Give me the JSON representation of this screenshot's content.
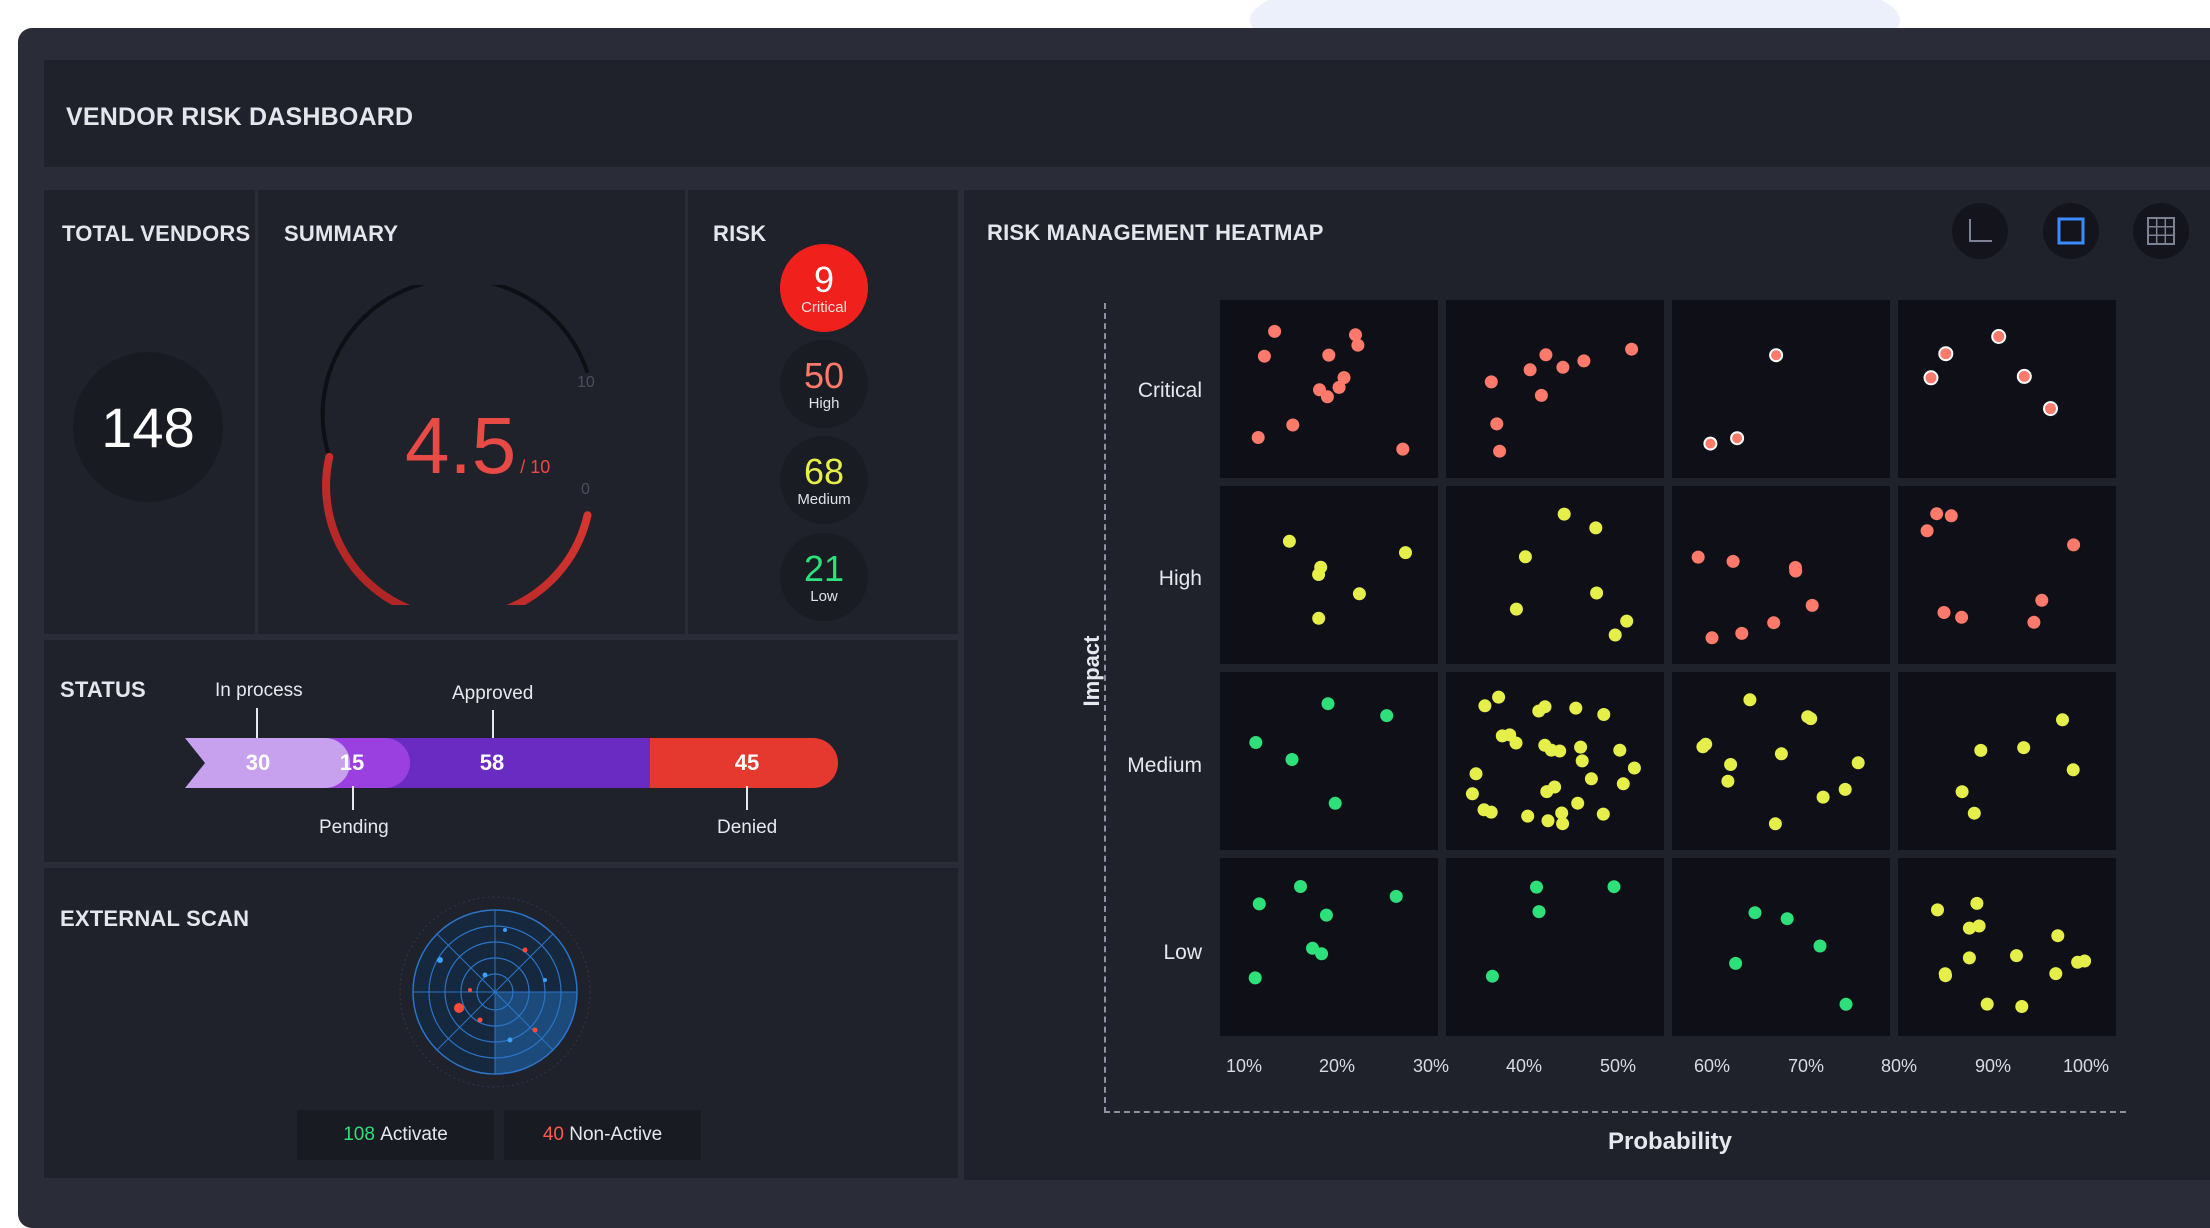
{
  "header": {
    "title": "VENDOR RISK DASHBOARD"
  },
  "total_vendors": {
    "title": "TOTAL VENDORS",
    "value": "148"
  },
  "summary": {
    "title": "SUMMARY",
    "score": "4.5",
    "score_suffix": "/ 10",
    "scale_max": "10",
    "scale_min": "0",
    "score_value": 4.5,
    "score_max": 10
  },
  "risk": {
    "title": "RISK",
    "items": [
      {
        "value": "9",
        "label": "Critical",
        "color": "#ff3b30"
      },
      {
        "value": "50",
        "label": "High",
        "color": "#ff7a6b"
      },
      {
        "value": "68",
        "label": "Medium",
        "color": "#e6ef4a"
      },
      {
        "value": "21",
        "label": "Low",
        "color": "#2ee07a"
      }
    ]
  },
  "status": {
    "title": "STATUS",
    "segments": [
      {
        "value": "30",
        "label": "In process",
        "color": "#c7a0ee"
      },
      {
        "value": "15",
        "label": "Pending",
        "color": "#9a3fe0"
      },
      {
        "value": "58",
        "label": "Approved",
        "color": "#6a2bc2"
      },
      {
        "value": "45",
        "label": "Denied",
        "color": "#e5392f"
      }
    ]
  },
  "external_scan": {
    "title": "EXTERNAL SCAN",
    "active_count": "108",
    "active_label": "Activate",
    "inactive_count": "40",
    "inactive_label": "Non-Active",
    "active_color": "#2ee07a",
    "inactive_color": "#ff5a4a"
  },
  "heatmap": {
    "title": "RISK MANAGEMENT HEATMAP",
    "y_axis_label": "Impact",
    "x_axis_label": "Probability",
    "rows": [
      "Critical",
      "High",
      "Medium",
      "Low"
    ],
    "x_ticks": [
      "10%",
      "20%",
      "30%",
      "40%",
      "50%",
      "60%",
      "70%",
      "80%",
      "90%",
      "100%"
    ],
    "view_icons": [
      "axes-icon",
      "square-icon",
      "grid-icon"
    ],
    "colors": {
      "critical": "#ff7a6b",
      "high": "#ff7a6b",
      "medium": "#e6ef4a",
      "low": "#2ee07a"
    },
    "cell_counts": [
      [
        12,
        9,
        3,
        5
      ],
      [
        6,
        7,
        8,
        8
      ],
      [
        5,
        30,
        12,
        6
      ],
      [
        7,
        4,
        5,
        14
      ]
    ]
  }
}
